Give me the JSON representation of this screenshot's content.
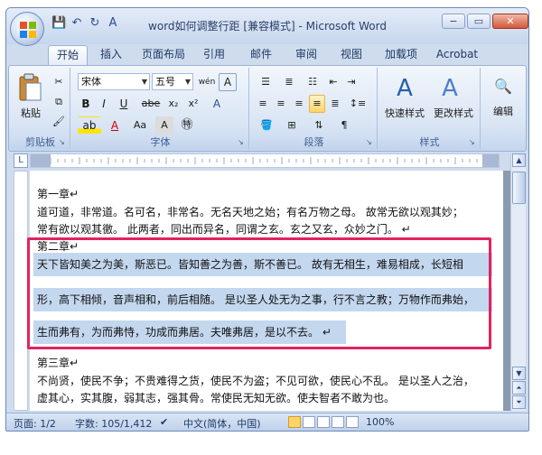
{
  "window": {
    "title": "word如何调整行距 [兼容模式] - Microsoft Word",
    "min": "−",
    "restore": "▭",
    "close": "✕"
  },
  "quick_access": {
    "save": "💾",
    "undo": "↶",
    "redo": "↻",
    "extra": "A"
  },
  "tabs": [
    {
      "label": "开始",
      "active": true
    },
    {
      "label": "插入"
    },
    {
      "label": "页面布局"
    },
    {
      "label": "引用"
    },
    {
      "label": "邮件"
    },
    {
      "label": "审阅"
    },
    {
      "label": "视图"
    },
    {
      "label": "加载项"
    },
    {
      "label": "Acrobat"
    }
  ],
  "ribbon": {
    "clipboard": {
      "label": "剪贴板",
      "paste": "粘贴"
    },
    "font": {
      "label": "字体",
      "family": "宋体",
      "size": "五号",
      "bold": "B",
      "italic": "I",
      "underline": "U",
      "strike": "abe",
      "sub": "x₂",
      "sup": "x²",
      "clear": "A",
      "case": "Aa",
      "wen": "wén",
      "grow": "A"
    },
    "paragraph": {
      "label": "段落"
    },
    "styles": {
      "label": "样式",
      "quick": "快速样式",
      "change": "更改样式"
    },
    "editing": {
      "label": "编辑"
    }
  },
  "ruler": {
    "tab_marker": "L"
  },
  "document": {
    "lines": [
      "第一章↵",
      "道可道，非常道。名可名，非常名。无名天地之始；有名万物之母。 故常无欲以观其妙；",
      "常有欲以观其徼。 此两者，同出而异名，同谓之玄。玄之又玄，众妙之门。 ↵",
      "第二章↵",
      "天下皆知美之为美，斯恶已。皆知善之为善，斯不善已。 故有无相生，难易相成，长短相",
      "形，高下相倾，音声相和，前后相随。 是以圣人处无为之事，行不言之教；万物作而弗始，",
      "生而弗有，为而弗恃，功成而弗居。夫唯弗居，是以不去。 ↵",
      "第三章↵",
      "不尚贤，使民不争；不贵难得之货，使民不为盗；不见可欲，使民心不乱。 是以圣人之治，",
      "虚其心，实其腹，弱其志，强其骨。常使民无知无欲。使夫智者不敢为也。"
    ]
  },
  "status": {
    "page": "页面: 1/2",
    "words": "字数: 105/1,412",
    "lang": "中文(简体，中国)",
    "zoom": "100%"
  },
  "colors": {
    "accent": "#2b4f8e",
    "selection": "#c3d7ef",
    "annotation": "#e0245e"
  }
}
